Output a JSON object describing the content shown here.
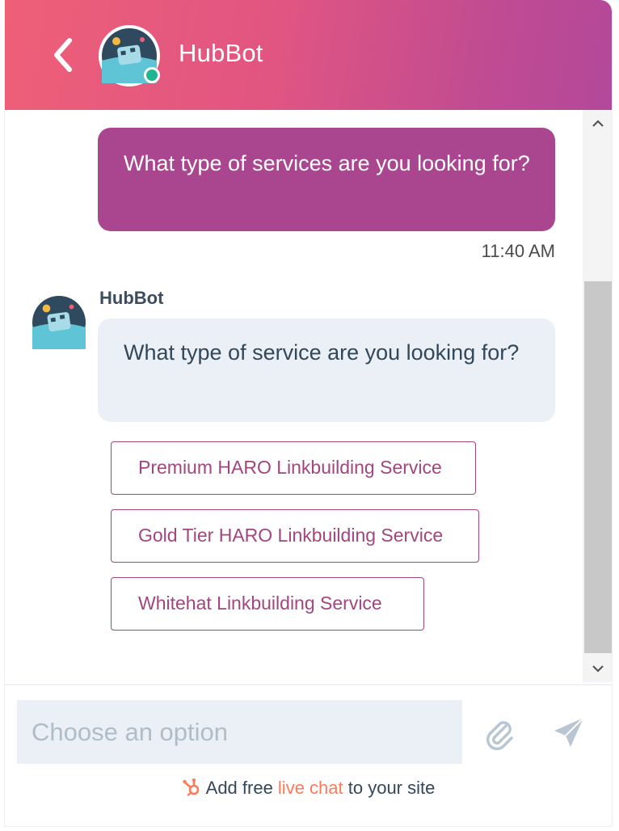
{
  "header": {
    "title": "HubBot",
    "back_icon": "chevron-left-icon",
    "avatar_icon": "bot-avatar-icon",
    "status": "online",
    "gradient_start": "#ef5f78",
    "gradient_end": "#b3489a"
  },
  "conversation": {
    "user_message": {
      "text": "What type of services are you looking for?",
      "time": "11:40 AM",
      "color": "#aa4690"
    },
    "bot_message": {
      "sender": "HubBot",
      "text": "What type of service are you looking for?",
      "color": "#eaf0f6"
    },
    "options": [
      {
        "label": "Premium HARO Linkbuilding Service"
      },
      {
        "label": "Gold Tier HARO Linkbuilding Service"
      },
      {
        "label": "Whitehat Linkbuilding Service"
      }
    ]
  },
  "composer": {
    "placeholder": "Choose an option",
    "value": "",
    "attach_icon": "paperclip-icon",
    "send_icon": "send-icon"
  },
  "footer": {
    "prefix": "Add free ",
    "link": "live chat",
    "suffix": " to your site",
    "brand_icon": "hubspot-sprocket-icon",
    "link_color": "#ff7a59"
  },
  "scrollbar": {
    "up_icon": "chevron-up-icon",
    "down_icon": "chevron-down-icon"
  }
}
